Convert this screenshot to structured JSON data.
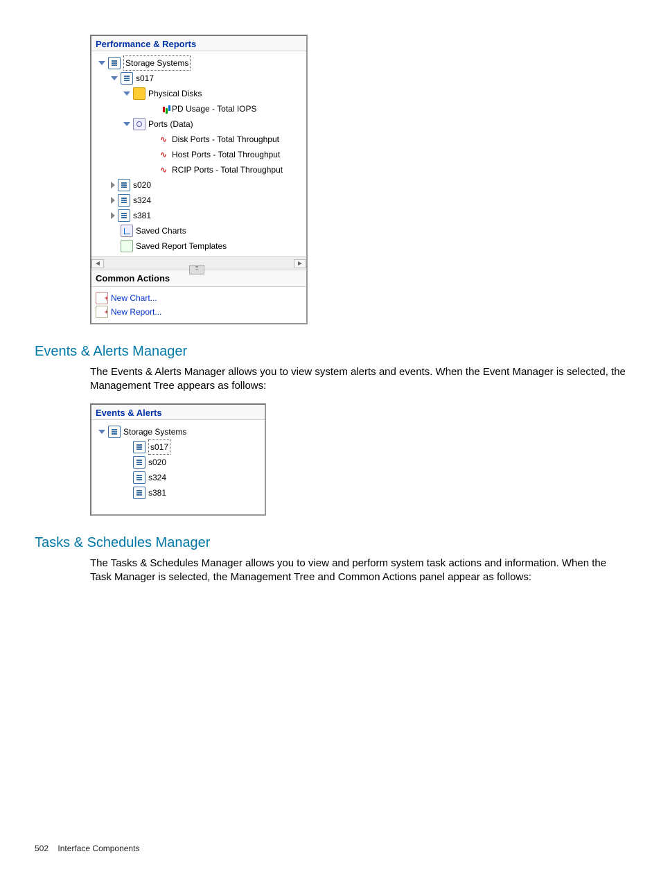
{
  "panel1": {
    "title": "Performance & Reports",
    "root": "Storage Systems",
    "sys_open": "s017",
    "pd_group": "Physical Disks",
    "pd_item": "PD Usage - Total IOPS",
    "ports_group": "Ports (Data)",
    "port_items": {
      "disk": "Disk Ports - Total Throughput",
      "host": "Host Ports - Total Throughput",
      "rcip": "RCIP Ports - Total Throughput"
    },
    "sys_closed": {
      "a": "s020",
      "b": "s324",
      "c": "s381"
    },
    "saved_charts": "Saved Charts",
    "saved_templates": "Saved Report Templates",
    "actions_header": "Common Actions",
    "new_chart": "New Chart...",
    "new_report": "New Report..."
  },
  "section1": {
    "heading": "Events & Alerts Manager",
    "body": "The Events & Alerts Manager allows you to view system alerts and events. When the Event Manager is selected, the Management Tree appears as follows:"
  },
  "panel2": {
    "title": "Events & Alerts",
    "root": "Storage Systems",
    "sys_selected": "s017",
    "sys": {
      "a": "s020",
      "b": "s324",
      "c": "s381"
    }
  },
  "section2": {
    "heading": "Tasks & Schedules Manager",
    "body": "The Tasks & Schedules Manager allows you to view and perform system task actions and information. When the Task Manager is selected, the Management Tree and Common Actions panel appear as follows:"
  },
  "footer": {
    "pagenum": "502",
    "section": "Interface Components"
  }
}
